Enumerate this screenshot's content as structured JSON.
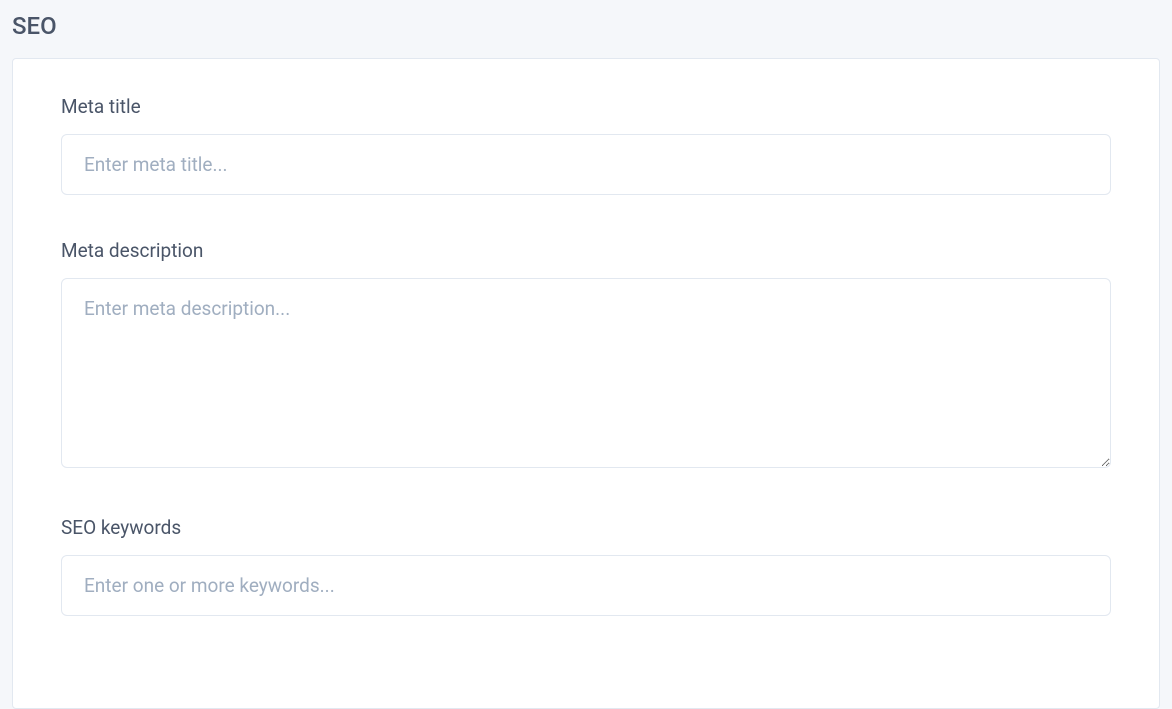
{
  "section": {
    "title": "SEO"
  },
  "form": {
    "meta_title": {
      "label": "Meta title",
      "placeholder": "Enter meta title...",
      "value": ""
    },
    "meta_description": {
      "label": "Meta description",
      "placeholder": "Enter meta description...",
      "value": ""
    },
    "seo_keywords": {
      "label": "SEO keywords",
      "placeholder": "Enter one or more keywords...",
      "value": ""
    }
  }
}
